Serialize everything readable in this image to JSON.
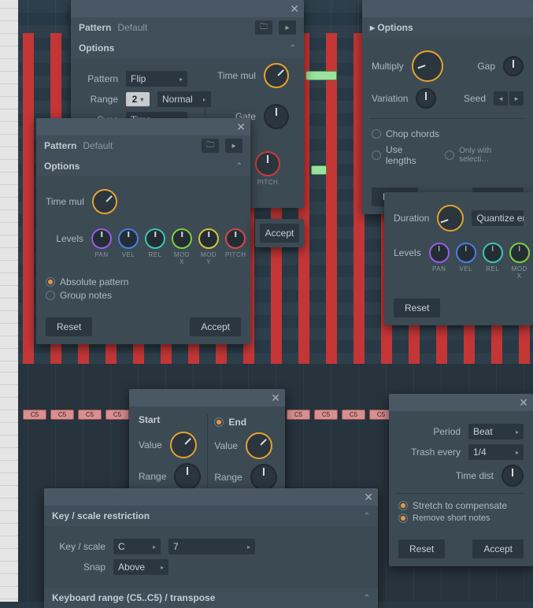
{
  "common": {
    "close": "✕",
    "reset": "Reset",
    "accept": "Accept",
    "folder_icon": "🗀",
    "arrow_icon": "▸",
    "chev_up": "⌃",
    "chev_down": "⌄"
  },
  "bg": {
    "note_label": "C5"
  },
  "panelA": {
    "header_label": "Pattern",
    "header_value": "Default",
    "section": "Options",
    "pattern_lbl": "Pattern",
    "pattern_val": "Flip",
    "range_lbl": "Range",
    "range_num": "2",
    "range_val": "Normal",
    "sync_lbl": "Sync",
    "sync_val": "Time",
    "timemul_lbl": "Time mul",
    "gate_lbl": "Gate",
    "pitch_lbl": "PITCH"
  },
  "panelB": {
    "header_label": "Pattern",
    "header_value": "Default",
    "section": "Options",
    "timemul_lbl": "Time mul",
    "levels_lbl": "Levels",
    "knobs": [
      {
        "label": "PAN",
        "color": "#9a5ce6"
      },
      {
        "label": "VEL",
        "color": "#4a7de6"
      },
      {
        "label": "REL",
        "color": "#3cc6b0"
      },
      {
        "label": "MOD X",
        "color": "#7dcf3c"
      },
      {
        "label": "MOD Y",
        "color": "#d6c23a"
      },
      {
        "label": "PITCH",
        "color": "#d34a4a"
      }
    ],
    "abs_pattern": "Absolute pattern",
    "group_notes": "Group notes"
  },
  "panelC": {
    "section": "Options",
    "multiply_lbl": "Multiply",
    "gap_lbl": "Gap",
    "variation_lbl": "Variation",
    "seed_lbl": "Seed",
    "chop_chords": "Chop chords",
    "use_lengths": "Use lengths",
    "only_sel": "Only with selecti…"
  },
  "panelD": {
    "duration_lbl": "Duration",
    "quantize": "Quantize end",
    "levels_lbl": "Levels",
    "knobs": [
      {
        "label": "PAN",
        "color": "#9a5ce6"
      },
      {
        "label": "VEL",
        "color": "#4a7de6"
      },
      {
        "label": "REL",
        "color": "#3cc6b0"
      },
      {
        "label": "MOD X",
        "color": "#7dcf3c"
      }
    ]
  },
  "panelE": {
    "start_lbl": "Start",
    "end_lbl": "End",
    "value_lbl": "Value",
    "range_lbl": "Range"
  },
  "panelF": {
    "section": "Key / scale restriction",
    "key_lbl": "Key / scale",
    "key_val": "C",
    "scale_val": "7",
    "snap_lbl": "Snap",
    "snap_val": "Above",
    "kbd_section": "Keyboard range (C5..C5) / transpose"
  },
  "panelG": {
    "period_lbl": "Period",
    "period_val": "Beat",
    "trash_lbl": "Trash every",
    "trash_val": "1/4",
    "time_dist_lbl": "Time dist",
    "stretch": "Stretch to compensate",
    "remove": "Remove short notes"
  }
}
